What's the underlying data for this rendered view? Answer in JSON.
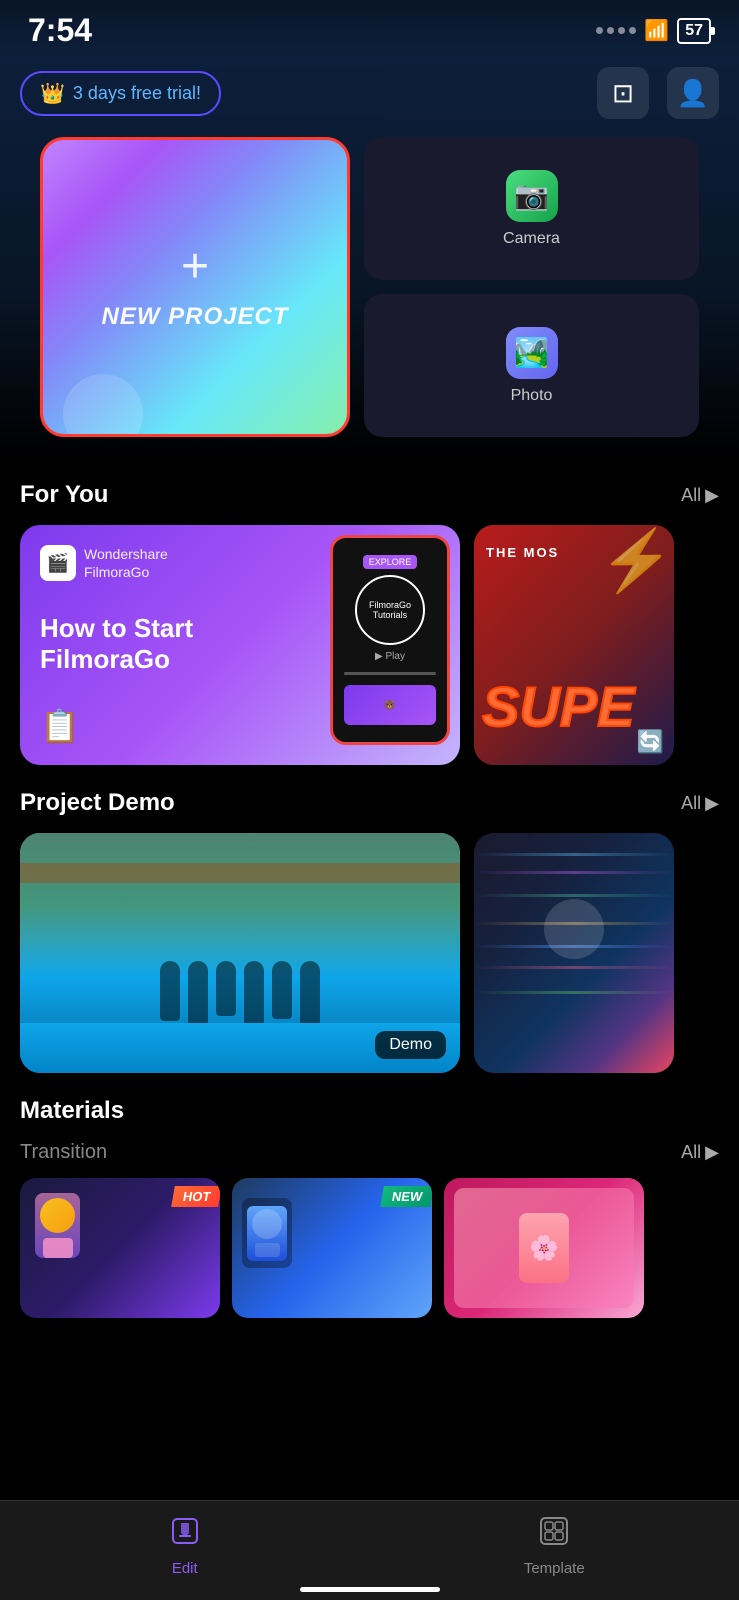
{
  "statusBar": {
    "time": "7:54",
    "battery": "57"
  },
  "header": {
    "trial_text": "3 days free",
    "trial_suffix": " trial!",
    "actions": [
      {
        "name": "video-projects-icon",
        "symbol": "⊡"
      },
      {
        "name": "profile-icon",
        "symbol": "⊙"
      }
    ]
  },
  "newProject": {
    "plus": "+",
    "label": "NEW PROJECT"
  },
  "sideButtons": [
    {
      "id": "camera",
      "label": "Camera"
    },
    {
      "id": "photo",
      "label": "Photo"
    }
  ],
  "forYou": {
    "title": "For You",
    "all_label": "All",
    "cards": [
      {
        "id": "filmorago-tutorial",
        "logo_text": "Wondershare\nFilmoraGo",
        "main_text": "How to Start\nFilmoraGo",
        "phone_label": "FilmoraGo\nTutorials"
      },
      {
        "id": "super-card",
        "top_text": "THE MOS",
        "main_text": "SUPE"
      }
    ]
  },
  "projectDemo": {
    "title": "Project Demo",
    "all_label": "All",
    "cards": [
      {
        "id": "pool-demo",
        "badge": "Demo"
      },
      {
        "id": "holographic-demo"
      }
    ]
  },
  "materials": {
    "title": "Materials",
    "transition": {
      "title": "Transition",
      "all_label": "All",
      "cards": [
        {
          "id": "t1",
          "badge": "HOT"
        },
        {
          "id": "t2",
          "badge": "NEW"
        },
        {
          "id": "t3"
        }
      ]
    }
  },
  "bottomNav": {
    "items": [
      {
        "id": "edit",
        "label": "Edit",
        "active": true
      },
      {
        "id": "template",
        "label": "Template",
        "active": false
      }
    ]
  }
}
